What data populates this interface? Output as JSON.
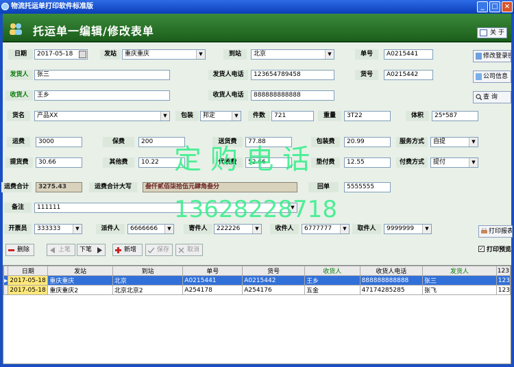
{
  "window": {
    "title": "物流托运单打印软件标准版",
    "min": "_",
    "max": "□",
    "close": "×"
  },
  "banner": {
    "title": "托运单一编辑/修改表单",
    "about": "关 于"
  },
  "form": {
    "date_label": "日期",
    "date_value": "2017-05-18",
    "from_label": "发站",
    "from_value": "重庆重庆",
    "to_label": "到站",
    "to_value": "北京",
    "order_label": "单号",
    "order_value": "A0215441",
    "sender_label": "发货人",
    "sender_value": "张三",
    "sender_phone_label": "发货人电话",
    "sender_phone_value": "123654789458",
    "cargo_no_label": "货号",
    "cargo_no_value": "A0215442",
    "receiver_label": "收货人",
    "receiver_value": "王乡",
    "receiver_phone_label": "收货人电话",
    "receiver_phone_value": "888888888888",
    "goods_label": "货名",
    "goods_value": "产品XX",
    "pack_label": "包装",
    "pack_value": "邦定",
    "pieces_label": "件数",
    "pieces_value": "721",
    "weight_label": "重量",
    "weight_value": "3T22",
    "volume_label": "体积",
    "volume_value": "25*587",
    "freight_label": "运费",
    "freight_value": "3000",
    "insurance_label": "保费",
    "insurance_value": "200",
    "delivery_label": "送货费",
    "delivery_value": "77.88",
    "packfee_label": "包装费",
    "packfee_value": "20.99",
    "service_label": "服务方式",
    "service_value": "自提",
    "pickup_label": "提货费",
    "pickup_value": "30.66",
    "other_label": "其他费",
    "other_value": "10.22",
    "cod_label": "代收费",
    "cod_value": "52.66",
    "advance_label": "垫付费",
    "advance_value": "12.55",
    "payment_label": "付费方式",
    "payment_value": "提付",
    "total_label": "运费合计",
    "total_value": "3275.43",
    "total_cn_label": "运费合计大写",
    "total_cn_value": "叁仟贰佰柒拾伍元肆角叁分",
    "receipt_label": "回单",
    "receipt_value": "5555555",
    "remark_label": "备注",
    "remark_value": "111111",
    "issuer_label": "开票员",
    "issuer_value": "333333",
    "dispatcher_label": "派件人",
    "dispatcher_value": "6666666",
    "mailer_label": "寄件人",
    "mailer_value": "222226",
    "collector_label": "收件人",
    "collector_value": "6777777",
    "picker_label": "取件人",
    "picker_value": "9999999"
  },
  "side_buttons": {
    "edit_login": "修改登录密码",
    "company": "公司信息",
    "query": "查 询",
    "print_template": "打印报表"
  },
  "toolbar": {
    "delete": "删除",
    "prev": "上笔",
    "next": "下笔",
    "add": "新增",
    "save": "保存",
    "cancel": "取消",
    "print_preview": "打印预览"
  },
  "watermark": {
    "line1": "定  购  电  话",
    "line2": "13628228718"
  },
  "grid": {
    "columns": [
      "日期",
      "发站",
      "到站",
      "单号",
      "货号",
      "收货人",
      "收货人电话",
      "发货人",
      "123"
    ],
    "rows": [
      [
        "2017-05-18",
        "重庆重庆",
        "北京",
        "A0215441",
        "A0215442",
        "王乡",
        "888888888888",
        "张三",
        "123"
      ],
      [
        "2017-05-18",
        "重庆重庆2",
        "北京北京2",
        "A254178",
        "A254176",
        "五金",
        "47174285285",
        "张飞",
        "123"
      ]
    ]
  }
}
